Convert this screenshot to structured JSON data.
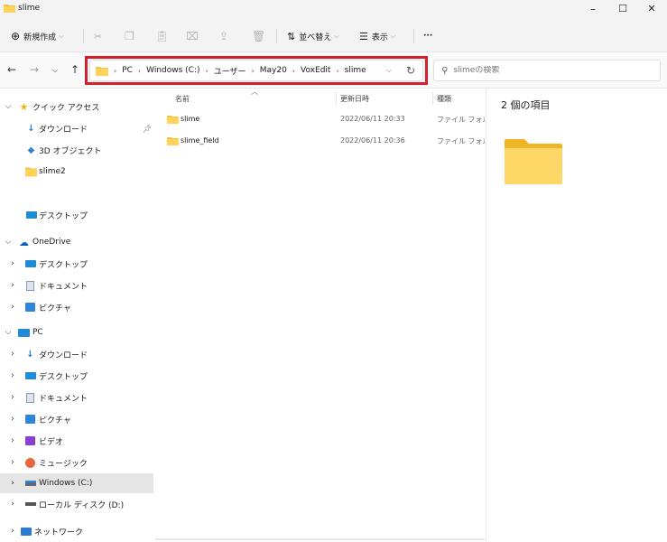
{
  "window": {
    "title": "slime",
    "minimize": "–",
    "maximize": "☐",
    "close": "✕"
  },
  "toolbar": {
    "new_label": "新規作成",
    "sort_label": "並べ替え",
    "view_label": "表示",
    "more_label": "···"
  },
  "address": {
    "crumbs": [
      "PC",
      "Windows (C:)",
      "ユーザー",
      "May20",
      "VoxEdit",
      "slime"
    ],
    "search_placeholder": "slimeの検索"
  },
  "sidebar": {
    "quick_access": {
      "label": "クイック アクセス",
      "items": [
        "ダウンロード",
        "3D オブジェクト",
        "slime2",
        "デスクトップ"
      ]
    },
    "onedrive": {
      "label": "OneDrive",
      "items": [
        "デスクトップ",
        "ドキュメント",
        "ピクチャ"
      ]
    },
    "pc": {
      "label": "PC",
      "items": [
        "ダウンロード",
        "デスクトップ",
        "ドキュメント",
        "ピクチャ",
        "ビデオ",
        "ミュージック",
        "Windows (C:)",
        "ローカル ディスク (D:)"
      ]
    },
    "network": {
      "label": "ネットワーク"
    }
  },
  "filelist": {
    "columns": {
      "name": "名前",
      "date": "更新日時",
      "type": "種類"
    },
    "rows": [
      {
        "name": "slime",
        "date": "2022/06/11 20:33",
        "type": "ファイル フォルダー"
      },
      {
        "name": "slime_field",
        "date": "2022/06/11 20:36",
        "type": "ファイル フォルダー"
      }
    ]
  },
  "details": {
    "count_label": "2 個の項目"
  },
  "colors": {
    "folder": "#f5c342",
    "highlight_border": "#d61f2c",
    "selected_bg": "#e5e5e5"
  }
}
